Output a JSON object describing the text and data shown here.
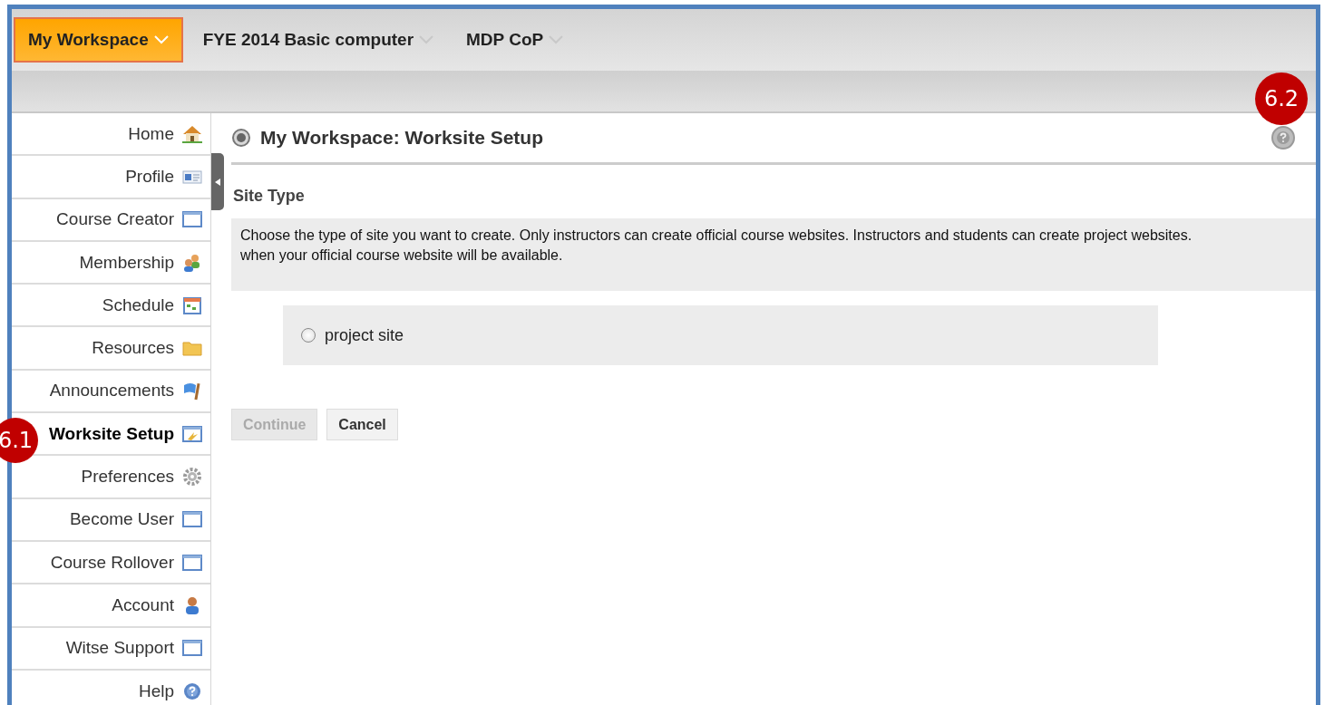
{
  "top_tabs": [
    {
      "label": "My Workspace",
      "selected": true
    },
    {
      "label": "FYE 2014 Basic computer",
      "selected": false
    },
    {
      "label": "MDP CoP",
      "selected": false
    }
  ],
  "sidebar": {
    "items": [
      {
        "label": "Home",
        "kind": "home",
        "selected": false
      },
      {
        "label": "Profile",
        "kind": "profile",
        "selected": false
      },
      {
        "label": "Course Creator",
        "kind": "window",
        "selected": false
      },
      {
        "label": "Membership",
        "kind": "people",
        "selected": false
      },
      {
        "label": "Schedule",
        "kind": "calendar",
        "selected": false
      },
      {
        "label": "Resources",
        "kind": "folder",
        "selected": false
      },
      {
        "label": "Announcements",
        "kind": "flag",
        "selected": false
      },
      {
        "label": "Worksite Setup",
        "kind": "setup",
        "selected": true
      },
      {
        "label": "Preferences",
        "kind": "gear",
        "selected": false
      },
      {
        "label": "Become User",
        "kind": "window",
        "selected": false
      },
      {
        "label": "Course Rollover",
        "kind": "window",
        "selected": false
      },
      {
        "label": "Account",
        "kind": "person",
        "selected": false
      },
      {
        "label": "Witse Support",
        "kind": "window",
        "selected": false
      },
      {
        "label": "Help",
        "kind": "help",
        "selected": false
      }
    ]
  },
  "page": {
    "title": "My Workspace: Worksite Setup",
    "section": "Site Type",
    "description": "Choose the type of site you want to create. Only instructors can create official course websites. Instructors and students can create project websites.\nwhen your official course website will be available.",
    "options": [
      {
        "label": "project site",
        "checked": false
      }
    ],
    "buttons": [
      {
        "label": "Continue",
        "disabled": true
      },
      {
        "label": "Cancel",
        "disabled": false
      }
    ]
  },
  "annotations": [
    {
      "label": "6.1",
      "kind": "sidebar"
    },
    {
      "label": "6.2",
      "kind": "help"
    }
  ]
}
